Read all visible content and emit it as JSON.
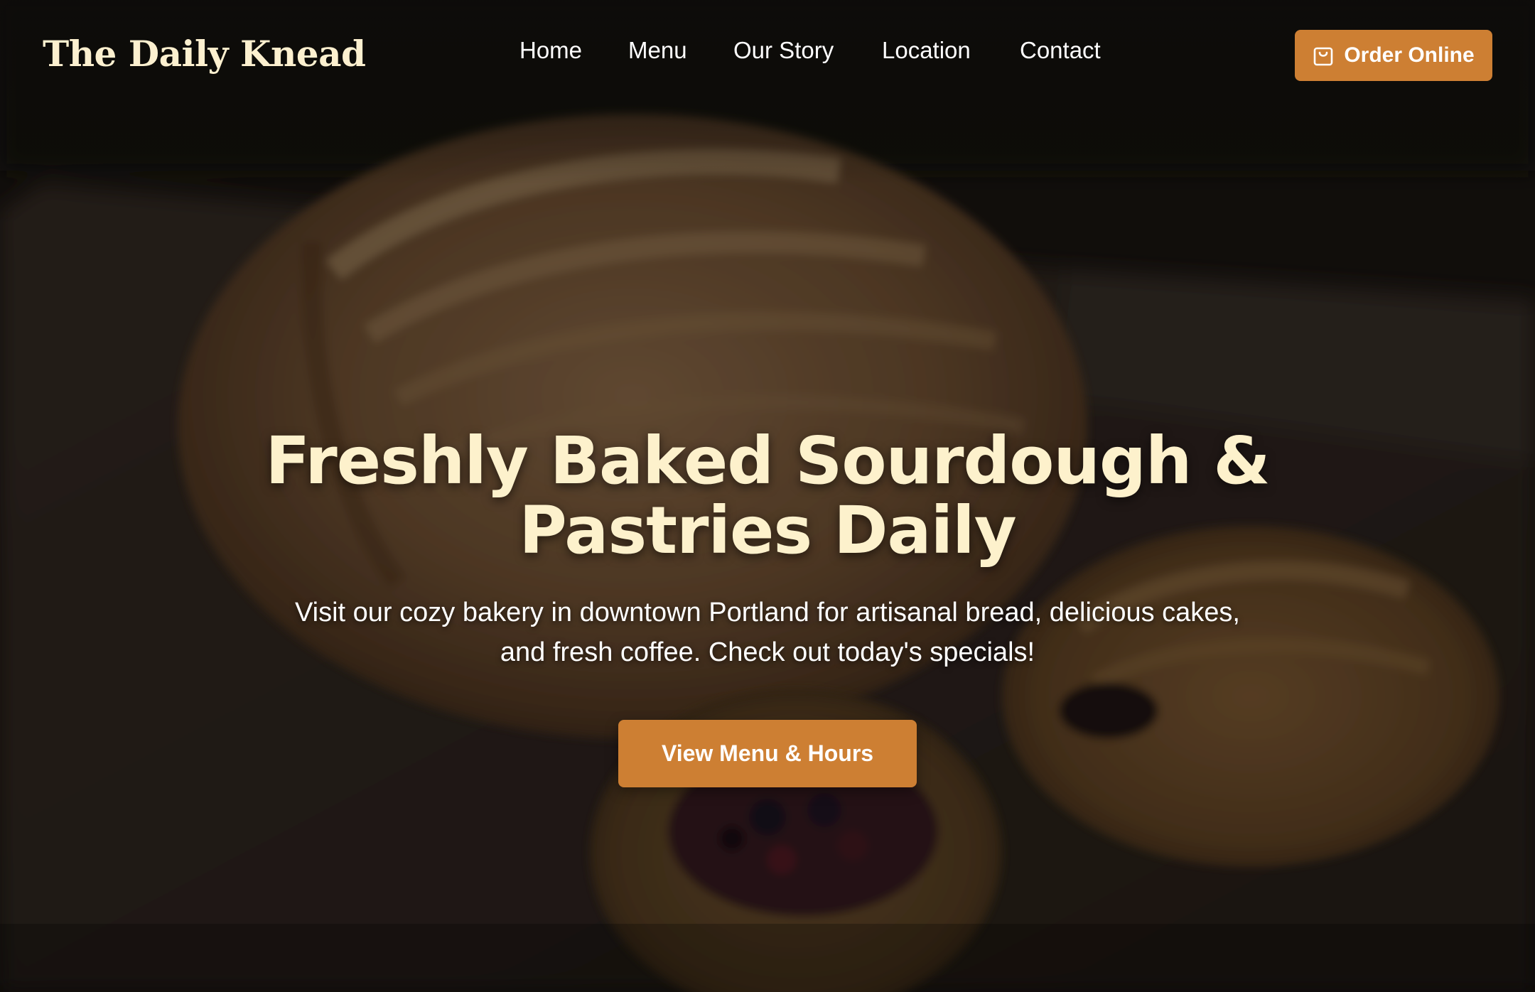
{
  "brand": {
    "name": "The Daily Knead"
  },
  "nav": {
    "items": [
      {
        "label": "Home"
      },
      {
        "label": "Menu"
      },
      {
        "label": "Our Story"
      },
      {
        "label": "Location"
      },
      {
        "label": "Contact"
      }
    ]
  },
  "header": {
    "order_button": {
      "label": "Order Online",
      "icon": "shopping-bag-icon"
    }
  },
  "hero": {
    "title": "Freshly Baked Sourdough & Pastries Daily",
    "subtitle": "Visit our cozy bakery in downtown Portland for artisanal bread, delicious cakes, and fresh coffee. Check out today's specials!",
    "cta_label": "View Menu & Hours",
    "background_image": "blurred-sourdough-loaf-and-pastries-photo"
  },
  "colors": {
    "accent": "#cd7f33",
    "title_cream": "#fdf1cc",
    "text_white": "#ffffff",
    "background_dark": "#1a1512"
  }
}
